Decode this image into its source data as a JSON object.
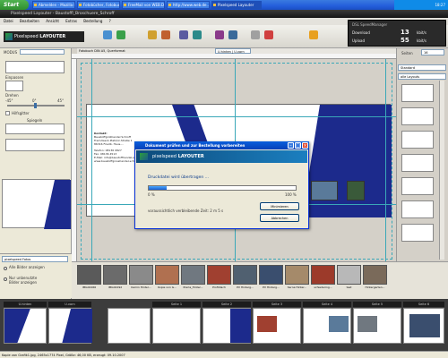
{
  "taskbar": {
    "start_label": "Start",
    "buttons": [
      "Abmelden - Mozilla Fi...",
      "Fotobücher, Fotobuc...",
      "FreeMail von WEB.DE...",
      "http://www.web.de...",
      "Pixelspeed Layouter"
    ],
    "clock": "18:27"
  },
  "app": {
    "title": "Pixelspeed Layouter - Baustoffl_Broschuere_Schroff",
    "logo_brand": "Pixelspeed",
    "logo_product": "LAYOUTER",
    "menu": [
      "Datei",
      "Bearbeiten",
      "Ansicht",
      "Extras",
      "Bestellung",
      "?"
    ]
  },
  "speedmanager": {
    "title": "DSL SpeedManager",
    "download_label": "Download",
    "download_value": "13",
    "upload_label": "Upload",
    "upload_value": "55",
    "unit": "kbit/s"
  },
  "leftpanel": {
    "modus_label": "MODUS",
    "einpassen_label": "Einpassen",
    "drehen_label": "Drehen",
    "rot_min": "-45°",
    "rot_mid": "0°",
    "rot_max": "45°",
    "hilfsgitter_label": "Hilfsgitter",
    "spiegeln_label": "Spiegeln",
    "fotos_header": "pixelspeed Fotos",
    "option_all": "Alle Bilder anzeigen",
    "option_unused": "Nur unbenutzte Bilder anzeigen"
  },
  "canvas": {
    "header_text": "Fotobuch DIN A5, Querformat",
    "view_select": "U.hinten | U.vorn",
    "page_lines": [
      "Kontakt:",
      "Baustoffgroßhandel Schroff",
      "Fremdwerk-Platz/rz-Straße 1",
      "86316 Friedb. Haus-...",
      "Telefon: 08136 0827",
      "Fax: 08136 4513",
      "E-Mail: info@baustoffhandel-schroff.de",
      "www.baustoffgrosshandel-schroff.de"
    ]
  },
  "rightpanel": {
    "seiten_label": "Seiten",
    "seiten_value": "16",
    "select1": "Standard",
    "select2": "alle Layouts"
  },
  "photos": [
    {
      "caption": "IMG02266",
      "color": "#5a5a5a"
    },
    {
      "caption": "IMG02292",
      "color": "#6b6b6b"
    },
    {
      "caption": "Kamin Hinter...",
      "color": "#8a8a8a"
    },
    {
      "caption": "Kopie von G...",
      "color": "#b07050"
    },
    {
      "caption": "Prerla_Hinter...",
      "color": "#707880"
    },
    {
      "caption": "Profildach",
      "color": "#a04030"
    },
    {
      "caption": "PV Hinterg...",
      "color": "#506070"
    },
    {
      "caption": "PV Hinterg...",
      "color": "#3a4e6e"
    },
    {
      "caption": "Sarna Hinter...",
      "color": "#a58a6a"
    },
    {
      "caption": "schiedering...",
      "color": "#9c3a2a"
    },
    {
      "caption": "test",
      "color": "#b8b8b8"
    },
    {
      "caption": "Hintergarten...",
      "color": "#7a6a5a"
    }
  ],
  "pagestrip": {
    "tabs": [
      "U.hinten",
      "U.vorn",
      "Seite 1",
      "Seite 2",
      "Seite 3",
      "Seite 4",
      "Seite 5",
      "Seite 6"
    ]
  },
  "status": {
    "text": "Kopie von Grafik1.jpg, 2465x1774 Pixel, Größe: 46,00 KB, erzeugt: 09.10.2007"
  },
  "dialog": {
    "title": "Dokument prüfen und zur Bestellung vorbereiten",
    "banner_brand": "pixelspeed",
    "banner_product": "LAYOUTER",
    "message": "Druckdatei wird übertragen ...",
    "pct_min": "0 %",
    "pct_max": "100 %",
    "progress": 0.12,
    "remaining": "voraussichtlich verbleibende Zeit: 2 m 5 s",
    "btn_minimize": "Minimieren",
    "btn_cancel": "Abbrechen"
  }
}
